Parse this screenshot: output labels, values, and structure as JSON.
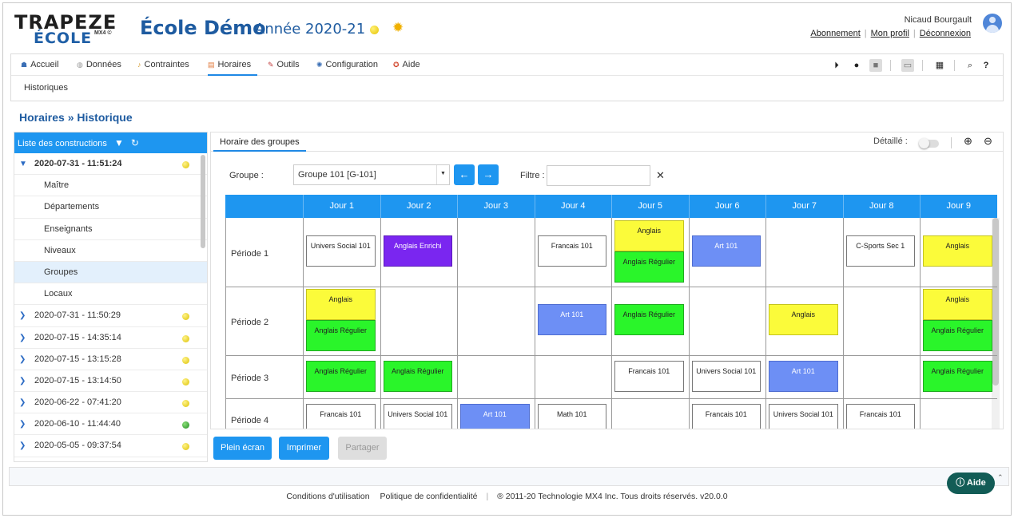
{
  "header": {
    "logo_line1": "TRAPEZE",
    "logo_line2": "ÉCOLE",
    "logo_small": "MX4 ©",
    "school_name": "École Démo",
    "year": "Année 2020-21",
    "user_name": "Nicaud Bourgault",
    "links": [
      "Abonnement",
      "Mon profil",
      "Déconnexion"
    ]
  },
  "nav": {
    "items": [
      {
        "label": "Accueil",
        "icon": "home-icon"
      },
      {
        "label": "Données",
        "icon": "database-icon"
      },
      {
        "label": "Contraintes",
        "icon": "constraints-icon"
      },
      {
        "label": "Horaires",
        "icon": "schedule-icon"
      },
      {
        "label": "Outils",
        "icon": "tools-icon"
      },
      {
        "label": "Configuration",
        "icon": "gear-icon"
      },
      {
        "label": "Aide",
        "icon": "help-lifebuoy-icon"
      }
    ],
    "active": "Horaires",
    "sub": "Historiques"
  },
  "breadcrumb": "Horaires » Historique",
  "left_panel": {
    "title": "Liste des constructions",
    "items": [
      {
        "label": "2020-07-31 - 11:51:24",
        "expanded": true,
        "status": "yellow"
      },
      {
        "label": "Maître",
        "sub": true
      },
      {
        "label": "Départements",
        "sub": true
      },
      {
        "label": "Enseignants",
        "sub": true
      },
      {
        "label": "Niveaux",
        "sub": true
      },
      {
        "label": "Groupes",
        "sub": true,
        "selected": true
      },
      {
        "label": "Locaux",
        "sub": true
      },
      {
        "label": "2020-07-31 - 11:50:29",
        "status": "yellow"
      },
      {
        "label": "2020-07-15 - 14:35:14",
        "status": "yellow"
      },
      {
        "label": "2020-07-15 - 13:15:28",
        "status": "yellow"
      },
      {
        "label": "2020-07-15 - 13:14:50",
        "status": "yellow"
      },
      {
        "label": "2020-06-22 - 07:41:20",
        "status": "yellow"
      },
      {
        "label": "2020-06-10 - 11:44:40",
        "status": "green"
      },
      {
        "label": "2020-05-05 - 09:37:54",
        "status": "yellow"
      }
    ]
  },
  "right_panel": {
    "tab": "Horaire des groupes",
    "detail_label": "Détaillé :",
    "group_label": "Groupe :",
    "group_value": "Groupe 101 [G-101]",
    "filter_label": "Filtre :",
    "filter_value": "",
    "days": [
      "Jour 1",
      "Jour 2",
      "Jour 3",
      "Jour 4",
      "Jour 5",
      "Jour 6",
      "Jour 7",
      "Jour 8",
      "Jour 9"
    ],
    "periods": [
      "Période 1",
      "Période 2",
      "Période 3",
      "Période 4"
    ],
    "cells": [
      {
        "period": 1,
        "day": 1,
        "slot": "full",
        "label": "Univers Social 101",
        "color": "#ffffff"
      },
      {
        "period": 1,
        "day": 2,
        "slot": "full",
        "label": "Anglais Enrichi",
        "color": "#7a26f0"
      },
      {
        "period": 1,
        "day": 4,
        "slot": "full",
        "label": "Francais 101",
        "color": "#ffffff"
      },
      {
        "period": 1,
        "day": 5,
        "slot": "top",
        "label": "Anglais",
        "color": "#fbfb3a"
      },
      {
        "period": 1,
        "day": 5,
        "slot": "bottom",
        "label": "Anglais Régulier",
        "color": "#2af52a"
      },
      {
        "period": 1,
        "day": 6,
        "slot": "full",
        "label": "Art 101",
        "color": "#6d8ff5"
      },
      {
        "period": 1,
        "day": 8,
        "slot": "full",
        "label": "C-Sports Sec 1",
        "color": "#ffffff"
      },
      {
        "period": 1,
        "day": 9,
        "slot": "full",
        "label": "Anglais",
        "color": "#fbfb3a"
      },
      {
        "period": 2,
        "day": 1,
        "slot": "top",
        "label": "Anglais",
        "color": "#fbfb3a"
      },
      {
        "period": 2,
        "day": 1,
        "slot": "bottom",
        "label": "Anglais Régulier",
        "color": "#2af52a"
      },
      {
        "period": 2,
        "day": 4,
        "slot": "full",
        "label": "Art 101",
        "color": "#6d8ff5"
      },
      {
        "period": 2,
        "day": 5,
        "slot": "full",
        "label": "Anglais Régulier",
        "color": "#2af52a"
      },
      {
        "period": 2,
        "day": 7,
        "slot": "full",
        "label": "Anglais",
        "color": "#fbfb3a"
      },
      {
        "period": 2,
        "day": 9,
        "slot": "top",
        "label": "Anglais",
        "color": "#fbfb3a"
      },
      {
        "period": 2,
        "day": 9,
        "slot": "bottom",
        "label": "Anglais Régulier",
        "color": "#2af52a"
      },
      {
        "period": 3,
        "day": 1,
        "slot": "full",
        "label": "Anglais Régulier",
        "color": "#2af52a"
      },
      {
        "period": 3,
        "day": 2,
        "slot": "full",
        "label": "Anglais Régulier",
        "color": "#2af52a"
      },
      {
        "period": 3,
        "day": 5,
        "slot": "full",
        "label": "Francais 101",
        "color": "#ffffff"
      },
      {
        "period": 3,
        "day": 6,
        "slot": "full",
        "label": "Univers Social 101",
        "color": "#ffffff"
      },
      {
        "period": 3,
        "day": 7,
        "slot": "full",
        "label": "Art 101",
        "color": "#6d8ff5"
      },
      {
        "period": 3,
        "day": 9,
        "slot": "full",
        "label": "Anglais Régulier",
        "color": "#2af52a"
      },
      {
        "period": 4,
        "day": 1,
        "slot": "full",
        "label": "Francais 101",
        "color": "#ffffff"
      },
      {
        "period": 4,
        "day": 2,
        "slot": "full",
        "label": "Univers Social 101",
        "color": "#ffffff"
      },
      {
        "period": 4,
        "day": 3,
        "slot": "full",
        "label": "Art 101",
        "color": "#6d8ff5"
      },
      {
        "period": 4,
        "day": 4,
        "slot": "full",
        "label": "Math 101",
        "color": "#ffffff"
      },
      {
        "period": 4,
        "day": 6,
        "slot": "full",
        "label": "Francais 101",
        "color": "#ffffff"
      },
      {
        "period": 4,
        "day": 7,
        "slot": "full",
        "label": "Univers Social 101",
        "color": "#ffffff"
      },
      {
        "period": 4,
        "day": 8,
        "slot": "full",
        "label": "Francais 101",
        "color": "#ffffff"
      }
    ]
  },
  "buttons": {
    "fullscreen": "Plein écran",
    "print": "Imprimer",
    "share": "Partager"
  },
  "help_button": "Aide",
  "footer": {
    "terms": "Conditions d'utilisation",
    "privacy": "Politique de confidentialité",
    "copyright": "® 2011-20 Technologie MX4 Inc. Tous droits réservés.  v20.0.0"
  }
}
